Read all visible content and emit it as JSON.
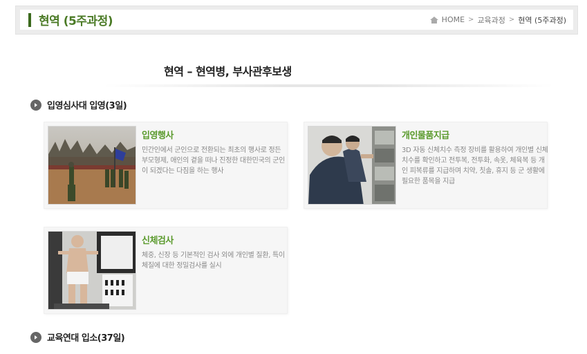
{
  "header": {
    "title": "현역 (5주과정)",
    "breadcrumb": [
      "HOME",
      "교육과정",
      "현역 (5주과정)"
    ],
    "accent_color": "#4a7a25"
  },
  "main": {
    "section_title": "현역 – 현역병, 부사관후보생",
    "sub_sections": [
      {
        "label": "입영심사대 입영(3일)",
        "cards": [
          {
            "title": "입영행사",
            "description": "민간인에서 군인으로 전환되는 최초의 행사로 정든 부모형제, 애인의 곁을 떠나 진정한 대한민국의 군인이 되겠다는 다짐을 하는 행사"
          },
          {
            "title": "개인물품지급",
            "description": "3D 자동 신체치수 측정 장비를 활용하여 개인별 신체치수를 확인하고 전투복, 전투화, 속옷, 체육복 등 개인 피복류를 지급하며 치약, 칫솔, 휴지 등 군 생활에 필요한 품목을 지급"
          },
          {
            "title": "신체검사",
            "description": "체중, 신장 등 기본적인 검사 외에 개인별 질환, 특이체질에 대한 정밀검사를 실시"
          }
        ]
      },
      {
        "label": "교육연대 입소(37일)",
        "cards": []
      }
    ]
  }
}
